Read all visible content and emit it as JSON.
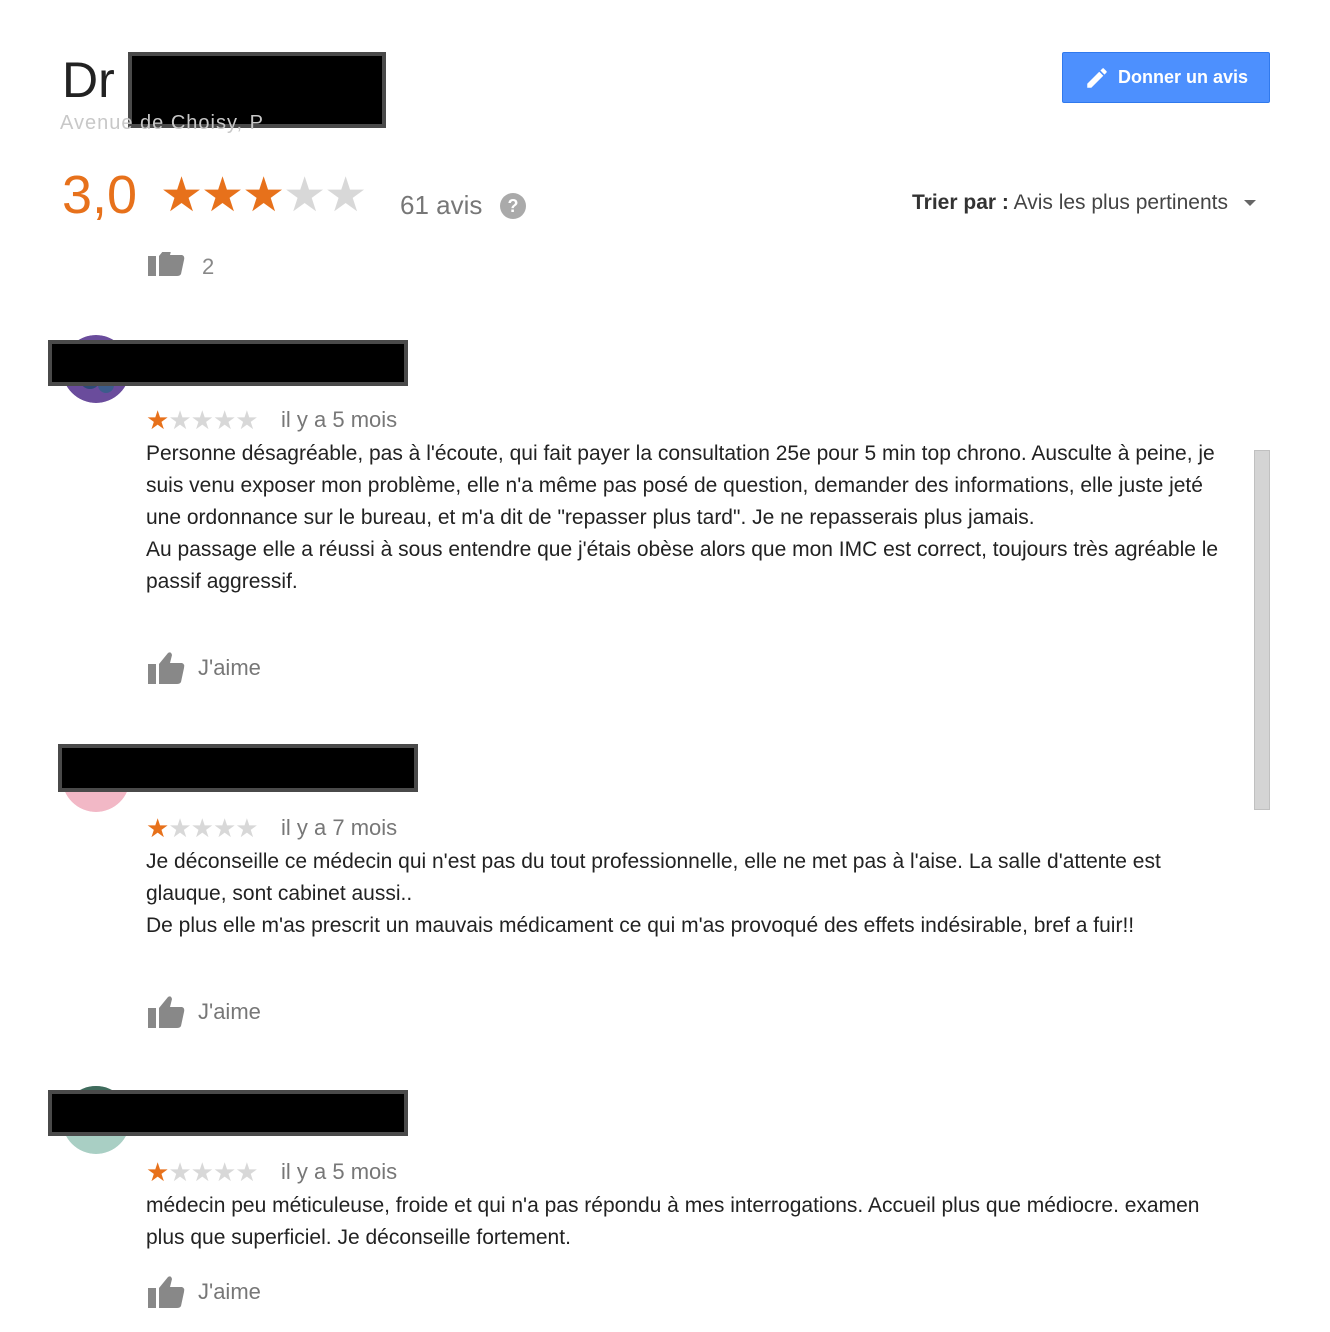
{
  "header": {
    "title_prefix": "Dr",
    "address_partial": "Avenue de Choisy, P"
  },
  "actions": {
    "give_review_label": "Donner un avis"
  },
  "summary": {
    "score": "3,0",
    "rating": 3,
    "max_rating": 5,
    "review_count": "61 avis",
    "help_icon": "?"
  },
  "sort": {
    "label": "Trier par :",
    "value": "Avis les plus pertinents"
  },
  "previous_review": {
    "like_count": "2"
  },
  "reviews": [
    {
      "rating": 1,
      "date": "il y a 5 mois",
      "text": "Personne désagréable, pas à l'écoute, qui fait payer la consultation 25e pour 5 min top chrono. Ausculte à peine, je suis venu exposer mon problème, elle n'a même pas posé de question, demander des informations, elle juste jeté une ordonnance sur le bureau, et m'a dit de \"repasser plus tard\". Je ne repasserais plus jamais.\nAu passage elle a réussi à sous entendre que j'étais obèse alors que mon IMC est correct, toujours très agréable le passif aggressif.",
      "like_label": "J'aime",
      "avatar_color": "#6a4c9c"
    },
    {
      "rating": 1,
      "date": "il y a 7 mois",
      "text": "Je déconseille ce médecin qui n'est pas du tout professionnelle, elle ne met pas à l'aise. La salle d'attente est glauque, sont cabinet aussi..\nDe plus elle m'as prescrit un mauvais médicament ce qui m'as provoqué des effets indésirable, bref a fuir!!",
      "like_label": "J'aime",
      "avatar_color": "#f2b8c6"
    },
    {
      "rating": 1,
      "date": "il y a 5 mois",
      "text": "médecin peu méticuleuse, froide et qui n'a pas répondu à mes interrogations. Accueil plus que médiocre. examen plus que superficiel. Je déconseille fortement.",
      "like_label": "J'aime",
      "avatar_color": "#a9cfc4"
    }
  ],
  "colors": {
    "accent": "#e7711b",
    "button": "#4d90fe",
    "star_off": "#d8d8d8"
  }
}
